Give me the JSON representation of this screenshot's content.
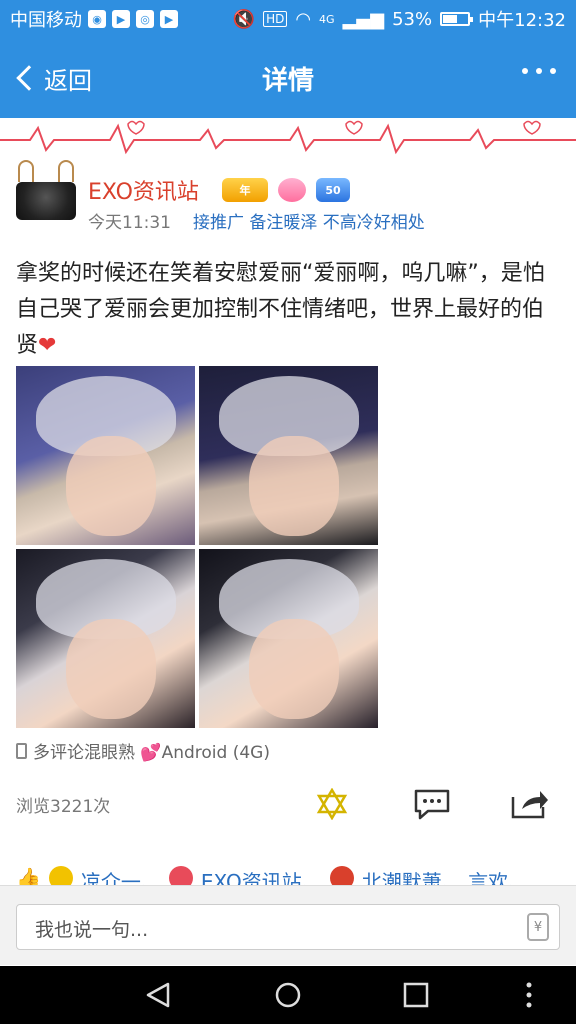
{
  "status_bar": {
    "carrier": "中国移动",
    "network": "4G",
    "battery": "53%",
    "battery_level": 0.53,
    "time": "中午12:32"
  },
  "nav": {
    "back_label": "返回",
    "title": "详情"
  },
  "post": {
    "username": "EXO资讯站",
    "badges": [
      "年",
      "",
      "50"
    ],
    "time": "今天11:31",
    "source_text": "接推广  备注暖泽 不高冷好相处",
    "content": "拿奖的时候还在笑着安慰爱丽“爱丽啊，呜几嘛”，是怕自己哭了爱丽会更加控制不住情绪吧，世界上最好的伯贤",
    "device": "多评论混眼熟 💕Android (4G)",
    "views": "浏览3221次"
  },
  "likes": {
    "names": [
      "凉介一、",
      "EXO资讯站、",
      "北潮默萧、 言欢、"
    ]
  },
  "comment": {
    "placeholder": "我也说一句...",
    "yuan_symbol": "¥"
  },
  "colors": {
    "accent": "#2f8fe0",
    "username": "#d9402c",
    "link": "#2a6fc0"
  }
}
